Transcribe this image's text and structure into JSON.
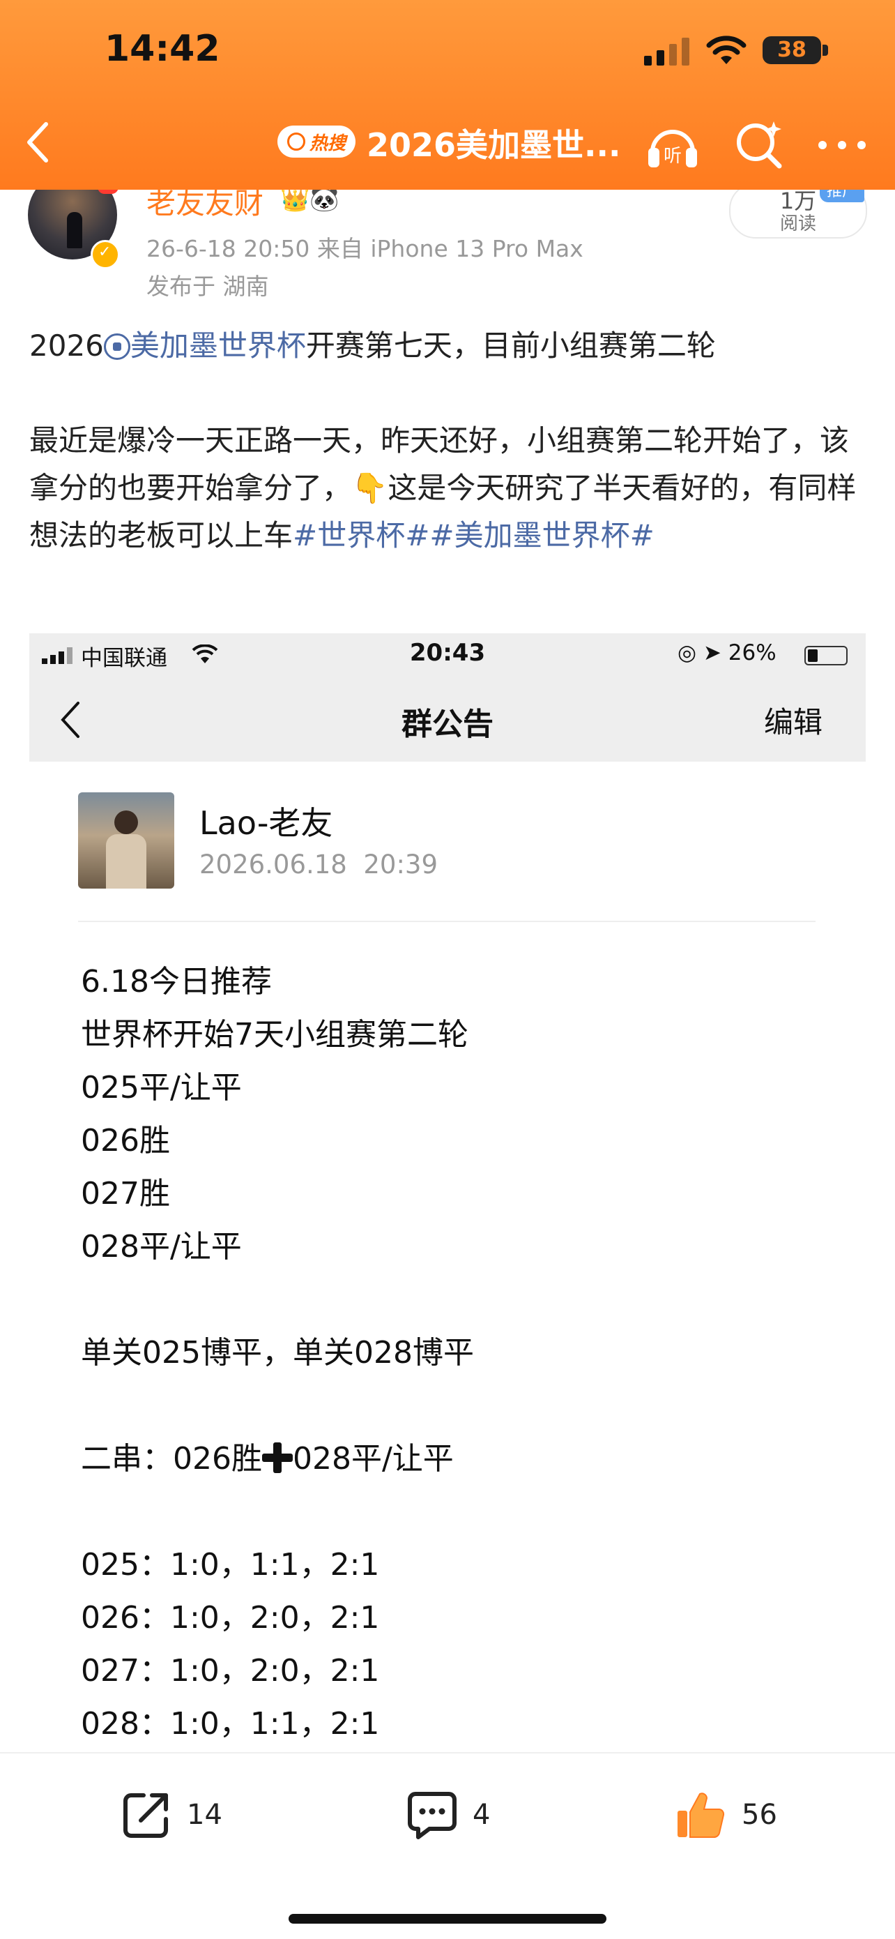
{
  "status_bar": {
    "time": "14:42",
    "battery": "38"
  },
  "nav": {
    "hot_badge": "热搜",
    "title": "2026美加墨世..."
  },
  "post": {
    "author": "老友友财",
    "author_icons": "👑🐼",
    "meta": "26-6-18 20:50  来自 iPhone 13 Pro Max",
    "location": "发布于 湖南",
    "read_count": "1万",
    "read_label": "阅读",
    "read_tag": "推广",
    "line1_prefix": "2026",
    "line1_link": "美加墨世界杯",
    "line1_suffix": "开赛第七天，目前小组赛第二轮",
    "para2_text1": "最近是爆冷一天正路一天，昨天还好，小组赛第二轮开始了，该拿分的也要开始拿分了，",
    "para2_emoji": "👇",
    "para2_text2": "这是今天研究了半天看好的，有同样想法的老板可以上车",
    "hashtag1": "#世界杯#",
    "hashtag2": "#美加墨世界杯#"
  },
  "embedded": {
    "carrier": "中国联通",
    "time": "20:43",
    "battery_pct": "26%",
    "title": "群公告",
    "edit": "编辑",
    "author_name": "Lao-老友",
    "author_date": "2026.06.18  20:39",
    "lines": [
      "6.18今日推荐",
      "世界杯开始7天小组赛第二轮",
      "025平/让平",
      "026胜",
      "027胜",
      "028平/让平",
      "",
      "单关025博平，单关028博平",
      "",
      "二串：026胜",
      "",
      "025：1:0，1:1，2:1",
      "026：1:0，2:0，2:1",
      "027：1:0，2:0，2:1",
      "028：1:0，1:1，2:1"
    ],
    "combo_suffix": "028平/让平"
  },
  "actions": {
    "share_count": "14",
    "comment_count": "4",
    "like_count": "56"
  },
  "colors": {
    "header": "#ff8a2a",
    "link": "#4c6aa5",
    "username": "#ff7a1e"
  }
}
